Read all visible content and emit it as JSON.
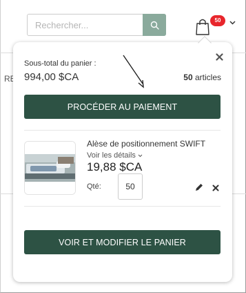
{
  "header": {
    "search": {
      "placeholder": "Rechercher...",
      "value": "",
      "button_icon": "search-icon"
    },
    "cart": {
      "icon": "shopping-bag-icon",
      "badge_count": "50",
      "badge_color": "#e8262c",
      "dropdown_icon": "chevron-down-icon"
    }
  },
  "background": {
    "stub_text": "REI"
  },
  "minicart": {
    "close_icon": "close-icon",
    "subtotal_label": "Sous-total du panier :",
    "subtotal_amount": "994,00 $CA",
    "items_count": "50",
    "items_label": "articles",
    "checkout_label": "PROCÉDER AU PAIEMENT",
    "view_cart_label": "VOIR ET MODIFIER LE PANIER",
    "annotation": "arrow-pointing-to-checkout",
    "items": [
      {
        "name": "Alèse de positionnement SWIFT",
        "details_label": "Voir les détails",
        "price": "19,88 $CA",
        "qty_label": "Qté:",
        "qty_value": "50",
        "image": "hospital-bed-pad-photo",
        "edit_icon": "pencil-icon",
        "remove_icon": "close-icon"
      }
    ]
  },
  "colors": {
    "primary_button": "#2d5244",
    "search_button": "#8aaa9c",
    "badge": "#e8262c",
    "text": "#333333"
  }
}
